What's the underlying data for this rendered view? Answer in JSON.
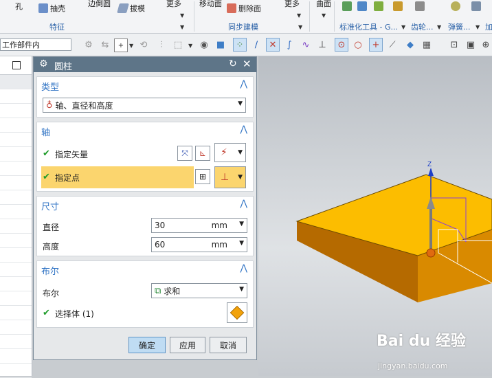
{
  "ribbon": {
    "items": [
      {
        "label": "孔"
      },
      {
        "label": "抽壳"
      },
      {
        "label": "边倒圆"
      },
      {
        "label": "拔模"
      },
      {
        "label": "更多"
      },
      {
        "label": "移动面"
      },
      {
        "label": "删除面"
      },
      {
        "label": "更多"
      },
      {
        "label": "曲面"
      }
    ],
    "groups": {
      "features": "特征",
      "sync_modeling": "同步建模",
      "std_parts": "标准化工具 - G...",
      "gear": "齿轮...",
      "spring": "弹簧...",
      "more": "加"
    }
  },
  "toolbar": {
    "filter_value": "工作部件内"
  },
  "dialog": {
    "title": "圆柱",
    "sections": {
      "type": {
        "title": "类型",
        "selected": "轴、直径和高度"
      },
      "axis": {
        "title": "轴",
        "specify_vector": "指定矢量",
        "specify_point": "指定点"
      },
      "dimensions": {
        "title": "尺寸",
        "diameter_label": "直径",
        "diameter_value": "30",
        "diameter_unit": "mm",
        "height_label": "高度",
        "height_value": "60",
        "height_unit": "mm"
      },
      "boolean": {
        "title": "布尔",
        "label": "布尔",
        "selected": "求和",
        "select_body": "选择体 (1)"
      }
    },
    "buttons": {
      "ok": "确定",
      "apply": "应用",
      "cancel": "取消"
    }
  },
  "viewport": {
    "axis_z": "Z"
  },
  "watermark": {
    "brand": "Bai du 经验",
    "url": "jingyan.baidu.com"
  },
  "colors": {
    "accent": "#2f73c4",
    "title_bar": "#5e7588",
    "highlight_row": "#fbd56e",
    "solid": "#f5b800",
    "check": "#1f9c2a"
  }
}
